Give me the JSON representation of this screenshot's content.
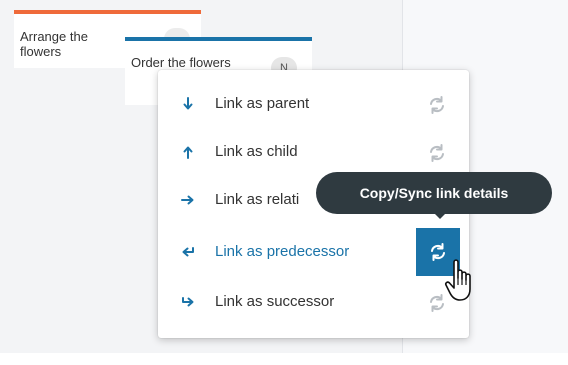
{
  "colors": {
    "accent": "#1a73a8",
    "card_a_bar": "#ef6a3a",
    "card_b_bar": "#1a73a8",
    "tooltip_bg": "#2f3a40",
    "sync_icon_idle": "#b9bec3",
    "arrow_icon": "#1a73a8"
  },
  "cards": [
    {
      "title": "Arrange the flowers",
      "avatar": ""
    },
    {
      "title": "Order the flowers",
      "avatar": "N"
    }
  ],
  "menu": {
    "items": [
      {
        "label": "Link as parent",
        "arrow_icon": "arrow-down-icon",
        "sync_icon": "sync-icon",
        "active": false
      },
      {
        "label": "Link as child",
        "arrow_icon": "arrow-up-icon",
        "sync_icon": "sync-icon",
        "active": false
      },
      {
        "label": "Link as relati",
        "arrow_icon": "arrow-right-icon",
        "sync_icon": "sync-icon",
        "active": false
      },
      {
        "label": "Link as predecessor",
        "arrow_icon": "arrow-return-left-icon",
        "sync_icon": "sync-icon",
        "active": true
      },
      {
        "label": "Link as successor",
        "arrow_icon": "arrow-return-right-icon",
        "sync_icon": "sync-icon",
        "active": false
      }
    ]
  },
  "tooltip": {
    "text": "Copy/Sync link details"
  },
  "cursor": {
    "icon": "hand-pointer-cursor-icon"
  }
}
